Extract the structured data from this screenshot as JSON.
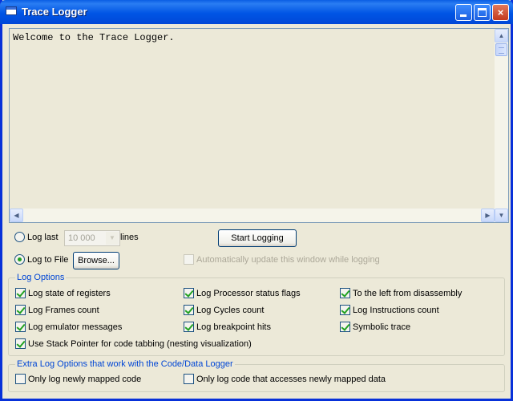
{
  "window": {
    "title": "Trace Logger",
    "buttons": {
      "minimize": "minimize",
      "maximize": "maximize",
      "close": "×"
    }
  },
  "log": {
    "text": "Welcome to the Trace Logger."
  },
  "controls": {
    "log_last_label": "Log last",
    "lines_value": "10 000",
    "lines_label": "lines",
    "start_logging": "Start Logging",
    "log_to_file_label": "Log to File",
    "browse": "Browse...",
    "auto_update": "Automatically update this window while logging",
    "selected_mode": "log_to_file"
  },
  "log_options": {
    "title": "Log Options",
    "items": [
      {
        "label": "Log state of registers",
        "checked": true
      },
      {
        "label": "Log Processor status flags",
        "checked": true
      },
      {
        "label": "To the left from disassembly",
        "checked": true
      },
      {
        "label": "Log Frames count",
        "checked": true
      },
      {
        "label": "Log Cycles count",
        "checked": true
      },
      {
        "label": "Log Instructions count",
        "checked": true
      },
      {
        "label": "Log emulator messages",
        "checked": true
      },
      {
        "label": "Log breakpoint hits",
        "checked": true
      },
      {
        "label": "Symbolic trace",
        "checked": true
      },
      {
        "label": "Use Stack Pointer for code tabbing (nesting visualization)",
        "checked": true
      }
    ]
  },
  "extra_options": {
    "title": "Extra Log Options that work with the Code/Data Logger",
    "items": [
      {
        "label": "Only log newly mapped code",
        "checked": false
      },
      {
        "label": "Only log code that accesses newly mapped data",
        "checked": false
      }
    ]
  },
  "colors": {
    "title_bar": "#0055e5",
    "group_title": "#0046d5",
    "check_mark": "#21a121"
  }
}
